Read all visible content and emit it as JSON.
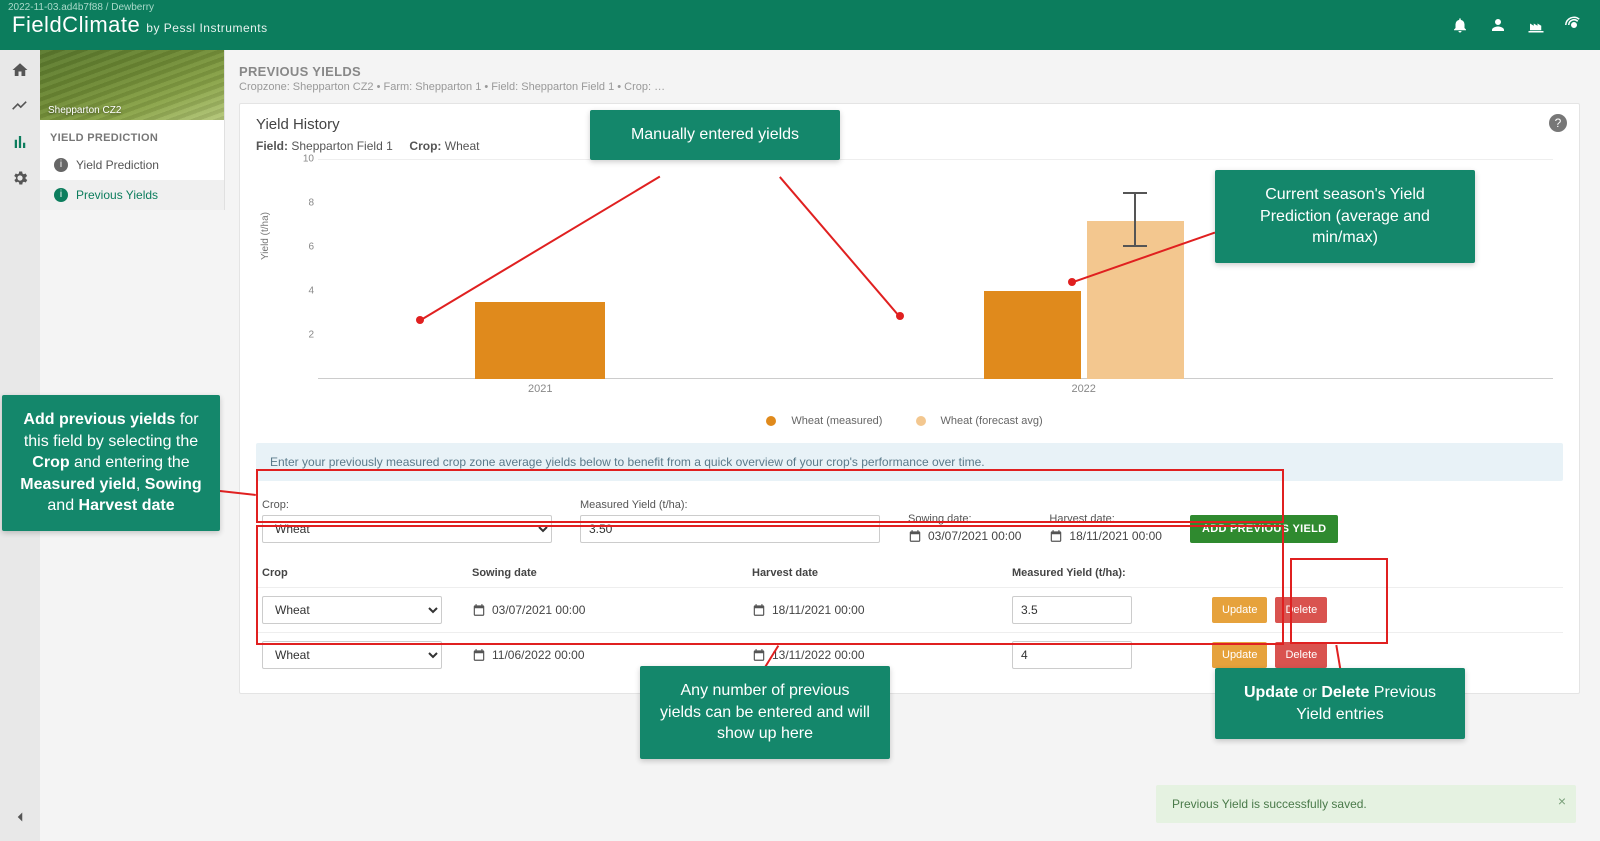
{
  "version_string": "2022-11-03.ad4b7f88 / Dewberry",
  "brand": {
    "name": "FieldClimate",
    "byline": "by Pessl Instruments"
  },
  "top_icons": [
    "bell-icon",
    "user-icon",
    "factory-icon",
    "broadcast-icon"
  ],
  "rail": {
    "items": [
      "home-icon",
      "measure-icon",
      "chart-icon",
      "gear-icon"
    ],
    "active_index": 2
  },
  "sidebar": {
    "banner_label": "Shepparton CZ2",
    "section_title": "YIELD PREDICTION",
    "items": [
      {
        "label": "Yield Prediction",
        "selected": false
      },
      {
        "label": "Previous Yields",
        "selected": true
      }
    ]
  },
  "header": {
    "title": "PREVIOUS YIELDS",
    "breadcrumb": "Cropzone: Shepparton CZ2 • Farm: Shepparton 1 • Field: Shepparton Field 1 • Crop: …"
  },
  "history_card": {
    "title": "Yield History",
    "field_label": "Field:",
    "field_value": "Shepparton Field 1",
    "crop_label": "Crop:",
    "crop_value": "Wheat",
    "ylabel": "Yield (t/ha)",
    "info_text": "Enter your previously measured crop zone average yields below to benefit from a quick overview of your crop's performance over time.",
    "legend": {
      "measured": "Wheat (measured)",
      "forecast": "Wheat (forecast avg)"
    }
  },
  "chart_data": {
    "type": "bar",
    "ylabel": "Yield (t/ha)",
    "ylim": [
      0,
      10
    ],
    "yticks": [
      2,
      4,
      6,
      8,
      10
    ],
    "categories": [
      "2021",
      "2022"
    ],
    "series": [
      {
        "name": "Wheat (measured)",
        "values": [
          3.5,
          4.0
        ],
        "color": "#e08a1c"
      },
      {
        "name": "Wheat (forecast avg)",
        "values": [
          null,
          7.2
        ],
        "error": [
          null,
          [
            6.0,
            8.4
          ]
        ],
        "color": "#f3c78f"
      }
    ]
  },
  "add_form": {
    "crop_label": "Crop:",
    "crop_value": "Wheat",
    "yield_label": "Measured Yield (t/ha):",
    "yield_value": "3.50",
    "sowing_label": "Sowing date:",
    "sowing_value": "03/07/2021 00:00",
    "harvest_label": "Harvest date:",
    "harvest_value": "18/11/2021 00:00",
    "button": "ADD PREVIOUS YIELD"
  },
  "table": {
    "headers": {
      "crop": "Crop",
      "sowing": "Sowing date",
      "harvest": "Harvest date",
      "yield": "Measured Yield (t/ha):"
    },
    "rows": [
      {
        "crop": "Wheat",
        "sowing": "03/07/2021 00:00",
        "harvest": "18/11/2021 00:00",
        "yield": "3.5"
      },
      {
        "crop": "Wheat",
        "sowing": "11/06/2022 00:00",
        "harvest": "13/11/2022 00:00",
        "yield": "4"
      }
    ],
    "update_label": "Update",
    "delete_label": "Delete"
  },
  "toast": {
    "text": "Previous Yield is successfully saved."
  },
  "callouts": {
    "c1": "Manually entered yields",
    "c2": "Current season's Yield Prediction (average and min/max)",
    "c3_html": "<b>Add previous yields</b> for this field by selecting the <b>Crop</b> and entering the <b>Measured yield</b>, <b>Sowing</b> and <b>Harvest date</b>",
    "c4": "Any number of previous yields can be entered and will show up here",
    "c5_html": "<b>Update</b> or <b>Delete</b> Previous Yield entries"
  }
}
